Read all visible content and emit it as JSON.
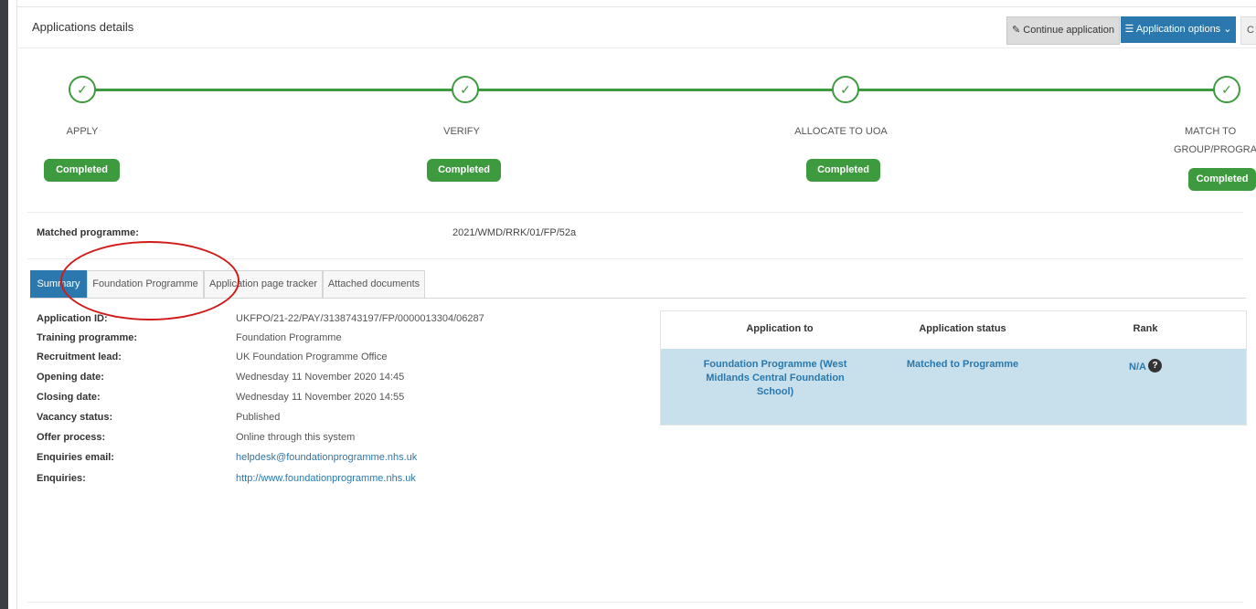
{
  "header": {
    "title": "Applications details",
    "continue_label": "Continue application",
    "options_label": "Application options",
    "extra_label": "C"
  },
  "stepper": {
    "steps": [
      {
        "label": "APPLY",
        "status": "Completed"
      },
      {
        "label": "VERIFY",
        "status": "Completed"
      },
      {
        "label": "ALLOCATE TO UOA",
        "status": "Completed"
      },
      {
        "label_line1": "MATCH TO",
        "label_line2": "GROUP/PROGRA",
        "status": "Completed"
      }
    ]
  },
  "matched": {
    "label": "Matched programme:",
    "value": "2021/WMD/RRK/01/FP/52a"
  },
  "tabs": [
    "Summary",
    "Foundation Programme",
    "Application page tracker",
    "Attached documents"
  ],
  "details": [
    {
      "label": "Application ID:",
      "value": "UKFPO/21-22/PAY/3138743197/FP/0000013304/06287"
    },
    {
      "label": "Training programme:",
      "value": "Foundation Programme"
    },
    {
      "label": "Recruitment lead:",
      "value": "UK Foundation Programme Office"
    },
    {
      "label": "Opening date:",
      "value": "Wednesday 11 November 2020 14:45"
    },
    {
      "label": "Closing date:",
      "value": "Wednesday 11 November 2020 14:55"
    },
    {
      "label": "Vacancy status:",
      "value": "Published"
    },
    {
      "label": "Offer process:",
      "value": "Online through this system"
    },
    {
      "label": "Enquiries email:",
      "value": "helpdesk@foundationprogramme.nhs.uk"
    },
    {
      "label": "Enquiries:",
      "value": "http://www.foundationprogramme.nhs.uk"
    }
  ],
  "table": {
    "headers": [
      "Application to",
      "Application status",
      "Rank"
    ],
    "row": {
      "application_to_l1": "Foundation Programme (West",
      "application_to_l2": "Midlands Central Foundation",
      "application_to_l3": "School)",
      "status": "Matched to Programme",
      "rank": "N/A"
    }
  },
  "icons": {
    "step": "check-icon",
    "continue": "pencil-icon",
    "options": "menu-icon",
    "options_dropdown": "chevron-down-icon",
    "rank_help": "question-icon"
  },
  "colors": {
    "accent_blue": "#2a78ad",
    "success_green": "#3e9a3e",
    "row_highlight": "#c8e0ec",
    "annotation_red": "#d11a1a"
  }
}
